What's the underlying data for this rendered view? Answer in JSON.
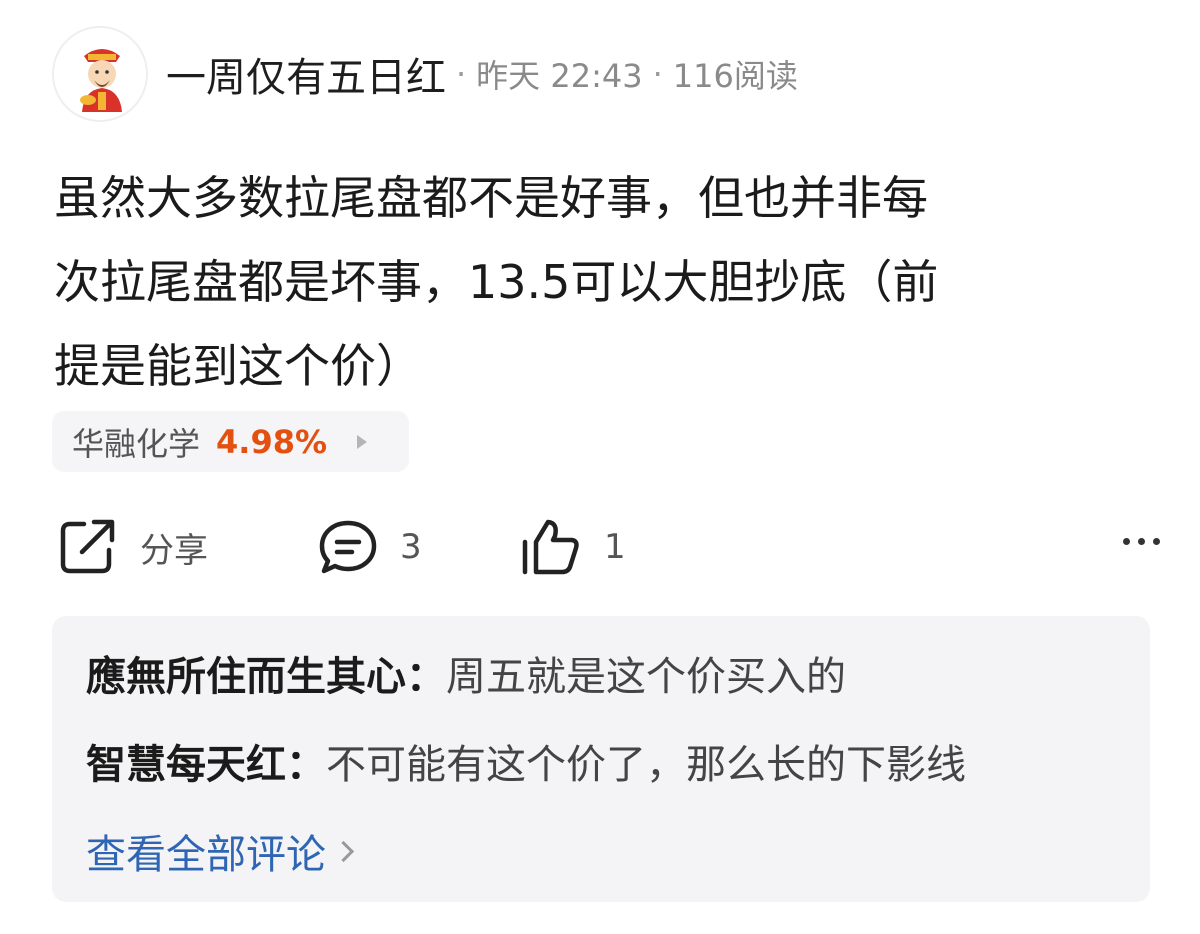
{
  "post": {
    "author": "一周仅有五日红",
    "time": "昨天 22:43",
    "reads": "116阅读",
    "separator": "·",
    "text": "虽然大多数拉尾盘都不是好事，但也并非每\n次拉尾盘都是坏事，13.5可以大胆抄底（前\n提是能到这个价）"
  },
  "stock": {
    "name": "华融化学",
    "change": "4.98%",
    "change_color": "#e3500f"
  },
  "actions": {
    "share_label": "分享",
    "comment_count": "3",
    "like_count": "1"
  },
  "comments": [
    {
      "user": "應無所住而生其心",
      "sep": "：",
      "text": "周五就是这个价买入的"
    },
    {
      "user": "智慧每天红",
      "sep": "：",
      "text": "不可能有这个价了，那么长的下影线"
    }
  ],
  "view_all_label": "查看全部评论",
  "icons": [
    "avatar-mascot-icon",
    "share-icon",
    "comment-icon",
    "like-icon",
    "more-icon",
    "chevron-right-icon"
  ]
}
